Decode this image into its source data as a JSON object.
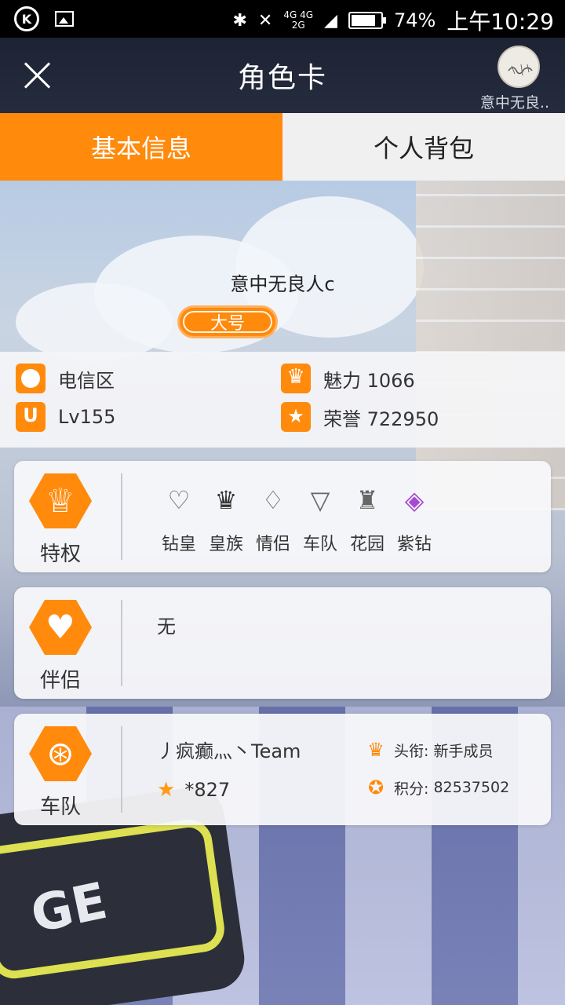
{
  "status_bar": {
    "network_type_top": "4G 4G",
    "network_type_bottom": "2G",
    "battery": "74%",
    "time": "上午10:29"
  },
  "header": {
    "title": "角色卡",
    "user_short": "意中无良.."
  },
  "tabs": [
    {
      "label": "基本信息",
      "active": true
    },
    {
      "label": "个人背包",
      "active": false
    }
  ],
  "profile": {
    "nickname": "意中无良人c",
    "badge": "大号"
  },
  "info": {
    "region": "电信区",
    "level": "Lv155",
    "charm": "魅力 1066",
    "honor": "荣誉 722950"
  },
  "privileges": {
    "label": "特权",
    "items": [
      {
        "name": "钻皇",
        "icon": "diamond-emperor-icon"
      },
      {
        "name": "皇族",
        "icon": "royal-crown-icon"
      },
      {
        "name": "情侣",
        "icon": "couple-heart-icon"
      },
      {
        "name": "车队",
        "icon": "team-shield-icon"
      },
      {
        "name": "花园",
        "icon": "garden-icon"
      },
      {
        "name": "紫钻",
        "icon": "purple-diamond-icon"
      }
    ]
  },
  "partner": {
    "label": "伴侣",
    "value": "无"
  },
  "team": {
    "label": "车队",
    "name": "丿疯癫灬丶Team",
    "id": "*827",
    "title_label": "头衔:",
    "title_value": "新手成员",
    "points_label": "积分:",
    "points_value": "82537502"
  },
  "colors": {
    "accent": "#ff8a0c",
    "header_bg": "#1d2333"
  }
}
